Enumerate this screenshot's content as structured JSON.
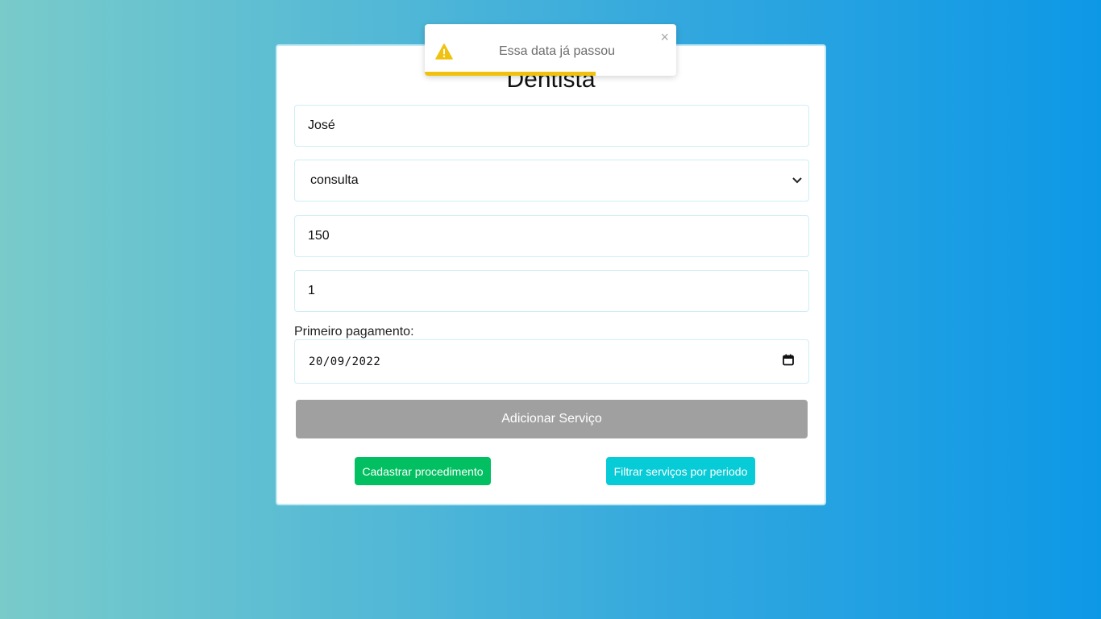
{
  "form": {
    "title": "Dentista",
    "name_value": "José",
    "service_selected": "consulta",
    "price_value": "150",
    "quantity_value": "1",
    "date_label": "Primeiro pagamento:",
    "date_value": "20/09/2022",
    "submit_label": "Adicionar Serviço",
    "register_procedure_label": "Cadastrar procedimento",
    "filter_label": "Filtrar serviços por periodo"
  },
  "toast": {
    "message": "Essa data já passou",
    "close_symbol": "×",
    "icon": "warning-icon",
    "progress_fraction": 0.68,
    "accent_color": "#f0c20f"
  },
  "colors": {
    "green_button": "#02c061",
    "cyan_button": "#07cbd6",
    "submit_button": "#a0a0a0"
  }
}
